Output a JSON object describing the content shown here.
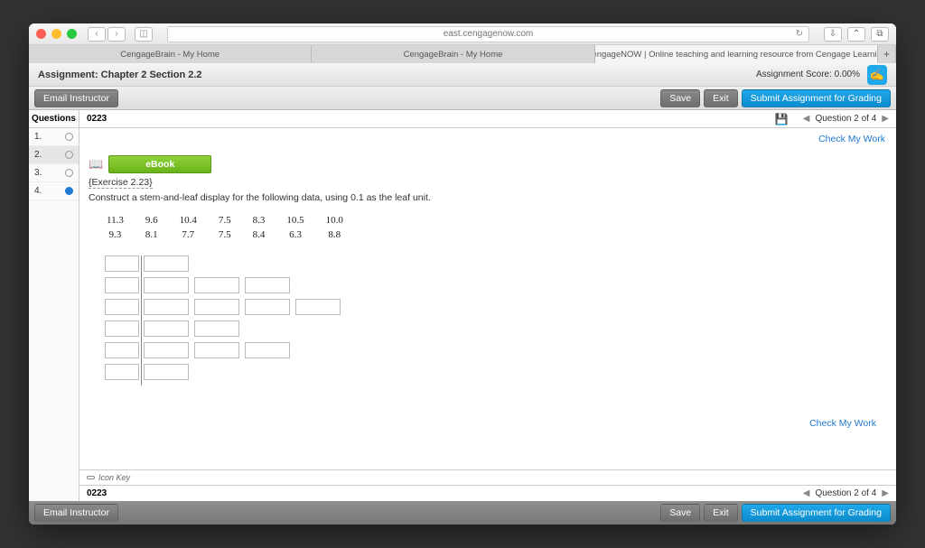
{
  "browser": {
    "url": "east.cengagenow.com",
    "tabs": [
      "CengageBrain - My Home",
      "CengageBrain - My Home",
      "CengageNOW | Online teaching and learning resource from Cengage Learning"
    ]
  },
  "assignment": {
    "title": "Assignment: Chapter 2 Section 2.2",
    "score_label": "Assignment Score: 0.00%"
  },
  "buttons": {
    "email_instructor": "Email Instructor",
    "save": "Save",
    "exit": "Exit",
    "submit": "Submit Assignment for Grading",
    "ebook": "eBook"
  },
  "sidebar": {
    "header": "Questions",
    "items": [
      {
        "num": "1."
      },
      {
        "num": "2."
      },
      {
        "num": "3."
      },
      {
        "num": "4."
      }
    ]
  },
  "question": {
    "id": "0223",
    "nav_label": "Question 2 of 4",
    "check_my_work": "Check My Work",
    "exercise_label": "{Exercise 2.23}",
    "prompt": "Construct a stem-and-leaf display for the following data, using 0.1 as the leaf unit.",
    "data_rows": [
      [
        "11.3",
        "9.6",
        "10.4",
        "7.5",
        "8.3",
        "10.5",
        "10.0"
      ],
      [
        "9.3",
        "8.1",
        "7.7",
        "7.5",
        "8.4",
        "6.3",
        "8.8"
      ]
    ],
    "stem_leaf_rows": [
      {
        "leaves": 1
      },
      {
        "leaves": 3
      },
      {
        "leaves": 4
      },
      {
        "leaves": 2
      },
      {
        "leaves": 3
      },
      {
        "leaves": 1
      }
    ],
    "icon_key": "Icon Key"
  }
}
